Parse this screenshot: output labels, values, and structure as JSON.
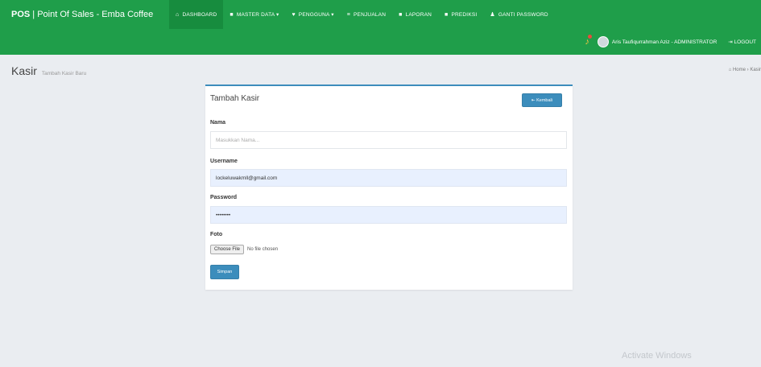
{
  "brand": {
    "bold": "POS",
    "rest": " | Point Of Sales - Emba Coffee"
  },
  "menu": [
    {
      "icon": "⌂",
      "icon_name": "home-icon",
      "label": "DASHBOARD",
      "active": true
    },
    {
      "icon": "■",
      "icon_name": "database-icon",
      "label": "MASTER DATA ▾"
    },
    {
      "icon": "♥",
      "icon_name": "users-icon",
      "label": "PENGGUNA ▾"
    },
    {
      "icon": "≡",
      "icon_name": "list-icon",
      "label": "PENJUALAN"
    },
    {
      "icon": "■",
      "icon_name": "report-icon",
      "label": "LAPORAN"
    },
    {
      "icon": "■",
      "icon_name": "prediction-icon",
      "label": "PREDIKSI"
    },
    {
      "icon": "♟",
      "icon_name": "key-icon",
      "label": "GANTI PASSWORD"
    }
  ],
  "user": {
    "name": "Aris Taufiqurrahman Aziz - ADMINISTRATOR"
  },
  "logout_label": "⇥ LOGOUT",
  "page": {
    "title": "Kasir",
    "subtitle": "Tambah Kasir Baru"
  },
  "breadcrumb": "⌂ Home  ›  Kasir",
  "form": {
    "title": "Tambah Kasir",
    "back_label": "⇤ Kembali",
    "nama": {
      "label": "Nama",
      "placeholder": "Masukkan Nama..."
    },
    "username": {
      "label": "Username",
      "value": "lockeluwakmll@gmail.com"
    },
    "password": {
      "label": "Password",
      "value": "••••••••"
    },
    "foto": {
      "label": "Foto",
      "button": "Choose File",
      "status": "No file chosen"
    },
    "submit_label": "Simpan"
  },
  "watermark": "Activate Windows",
  "colors": {
    "navbar": "#1f9e4a",
    "primary": "#3c8dbc",
    "background": "#eaedf1"
  }
}
